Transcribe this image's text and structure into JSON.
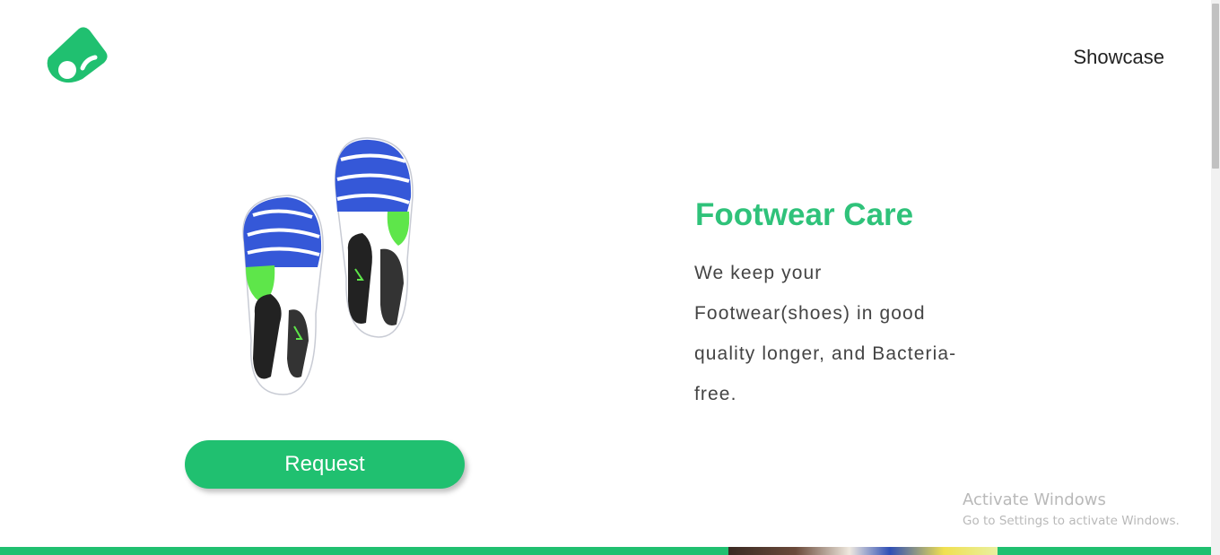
{
  "header": {
    "logo_icon": "brand-logo-icon",
    "nav_link": "Showcase"
  },
  "hero": {
    "image": "sneaker-soles-image",
    "button_label": "Request",
    "title": "Footwear Care",
    "description": "We keep your Footwear(shoes) in good quality longer, and Bacteria-free."
  },
  "watermark": {
    "title": "Activate Windows",
    "subtitle": "Go to Settings to activate Windows."
  },
  "colors": {
    "brand_green": "#20c070",
    "title_green": "#2fc27a",
    "sole_blue": "#3558d8",
    "accent_lime": "#5ee64a"
  }
}
